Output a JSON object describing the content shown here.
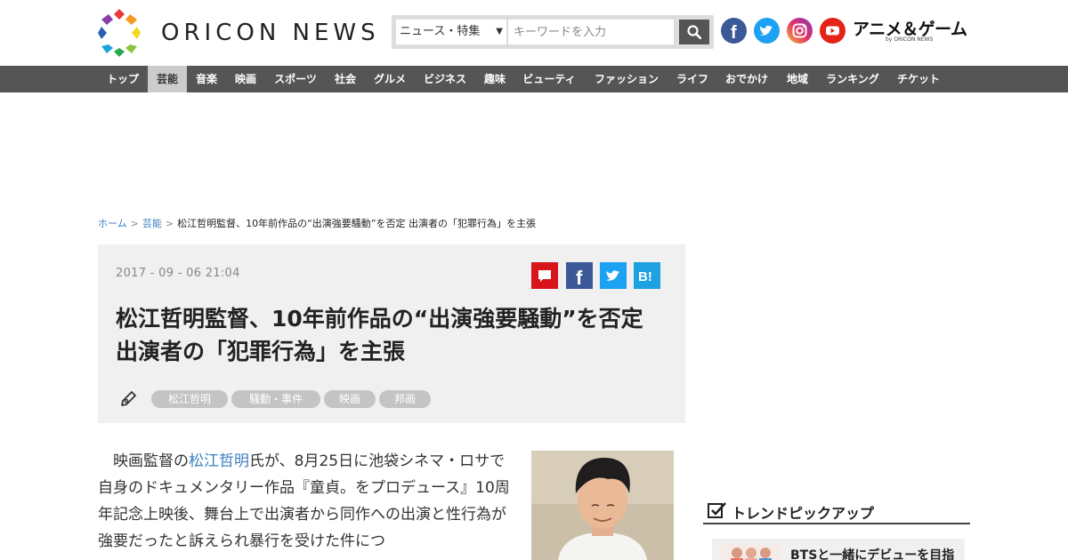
{
  "header": {
    "logo_text": "ORICON NEWS",
    "search": {
      "category": "ニュース・特集",
      "placeholder": "キーワードを入力"
    },
    "social": [
      "facebook-icon",
      "twitter-icon",
      "instagram-icon",
      "youtube-icon"
    ],
    "anime_game": {
      "label": "アニメ＆ゲーム",
      "sub": "by ORICON NEWS"
    }
  },
  "nav": {
    "items": [
      "トップ",
      "芸能",
      "音楽",
      "映画",
      "スポーツ",
      "社会",
      "グルメ",
      "ビジネス",
      "趣味",
      "ビューティ",
      "ファッション",
      "ライフ",
      "おでかけ",
      "地域",
      "ランキング",
      "チケット"
    ],
    "active": "芸能"
  },
  "breadcrumb": {
    "home": "ホーム",
    "category": "芸能",
    "current": "松江哲明監督、10年前作品の“出演強要騒動”を否定 出演者の「犯罪行為」を主張"
  },
  "article": {
    "date": "2017 - 09 - 06  21:04",
    "title": "松江哲明監督、10年前作品の“出演強要騒動”を否定 出演者の「犯罪行為」を主張",
    "tags": [
      "松江哲明",
      "騒動・事件",
      "映画",
      "邦画"
    ],
    "share": {
      "hatena_label": "B!"
    },
    "body": {
      "before_link": "映画監督の",
      "link": "松江哲明",
      "after_link": "氏が、8月25日に池袋シネマ・ロサで自身のドキュメンタリー作品『童貞。をプロデュース』10周年記念上映後、舞台上で出演者から同作への出演と性行為が強要だったと訴えられ暴行を受けた件につ"
    }
  },
  "sidebar": {
    "trend_title": "トレンドピックアップ",
    "trend_items": [
      "BTSと一緒にデビューを目指"
    ]
  },
  "colors": {
    "nav_bg": "#555555",
    "link": "#3a7fc1",
    "facebook": "#3b5998",
    "twitter": "#1da1f2",
    "youtube": "#e62117",
    "comment": "#d7141a"
  }
}
